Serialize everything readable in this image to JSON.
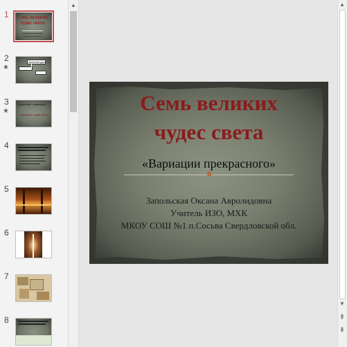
{
  "thumbnails": [
    {
      "number": "1",
      "star": ""
    },
    {
      "number": "2",
      "star": "★"
    },
    {
      "number": "3",
      "star": "★"
    },
    {
      "number": "4",
      "star": ""
    },
    {
      "number": "5",
      "star": ""
    },
    {
      "number": "6",
      "star": ""
    },
    {
      "number": "7",
      "star": ""
    },
    {
      "number": "8",
      "star": ""
    }
  ],
  "slide": {
    "title_line1": "Семь великих",
    "title_line2": "чудес света",
    "subtitle": "«Вариации прекрасного»",
    "author_name": "Запольская Оксана Авролидовна",
    "author_role": "Учитель ИЗО, МХК",
    "author_school": "МКОУ СОШ №1 п.Сосьва Свердловской обл."
  },
  "thumb1": {
    "title": "Семь великих чудес света"
  },
  "thumb2": {
    "label": "Архитектура"
  },
  "thumb3": {
    "heading": "Искусство - вариации",
    "text": "Вариации чудес света"
  },
  "icons": {
    "up": "▲",
    "down": "▼",
    "prev_slide": "⇞",
    "next_slide": "⇟"
  },
  "colors": {
    "selected": "#c0504d",
    "title": "#8a1c1c"
  }
}
